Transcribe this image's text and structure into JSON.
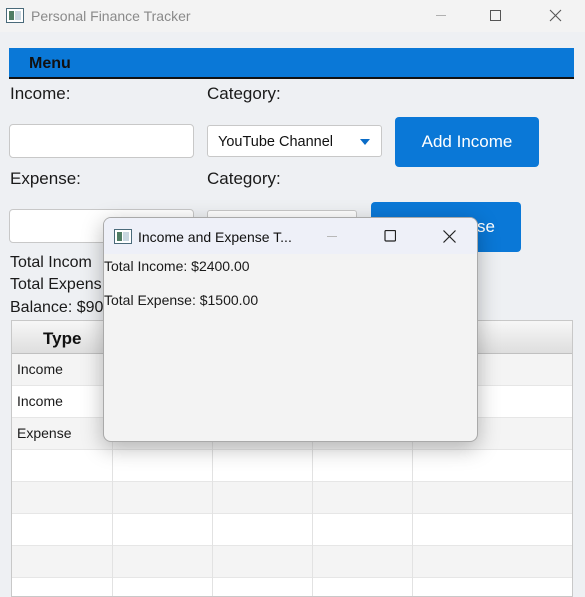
{
  "window": {
    "title": "Personal Finance Tracker"
  },
  "menu": {
    "label": "Menu"
  },
  "income": {
    "label": "Income:",
    "value": "",
    "category_label": "Category:",
    "category_value": "YouTube Channel",
    "button": "Add Income"
  },
  "expense": {
    "label": "Expense:",
    "value": "",
    "category_label": "Category:",
    "button_visible_text": "se"
  },
  "summary": {
    "total_income_partial": "Total Incom",
    "total_expense_partial": "Total Expens",
    "balance_partial": "Balance: $90"
  },
  "table": {
    "columns": [
      "Type"
    ],
    "rows": [
      {
        "type": "Income"
      },
      {
        "type": "Income"
      },
      {
        "type": "Expense"
      }
    ]
  },
  "dialog": {
    "title": "Income and Expense T...",
    "total_income": "Total Income: $2400.00",
    "total_expense": "Total Expense: $1500.00"
  },
  "colors": {
    "accent": "#0a78d7"
  }
}
